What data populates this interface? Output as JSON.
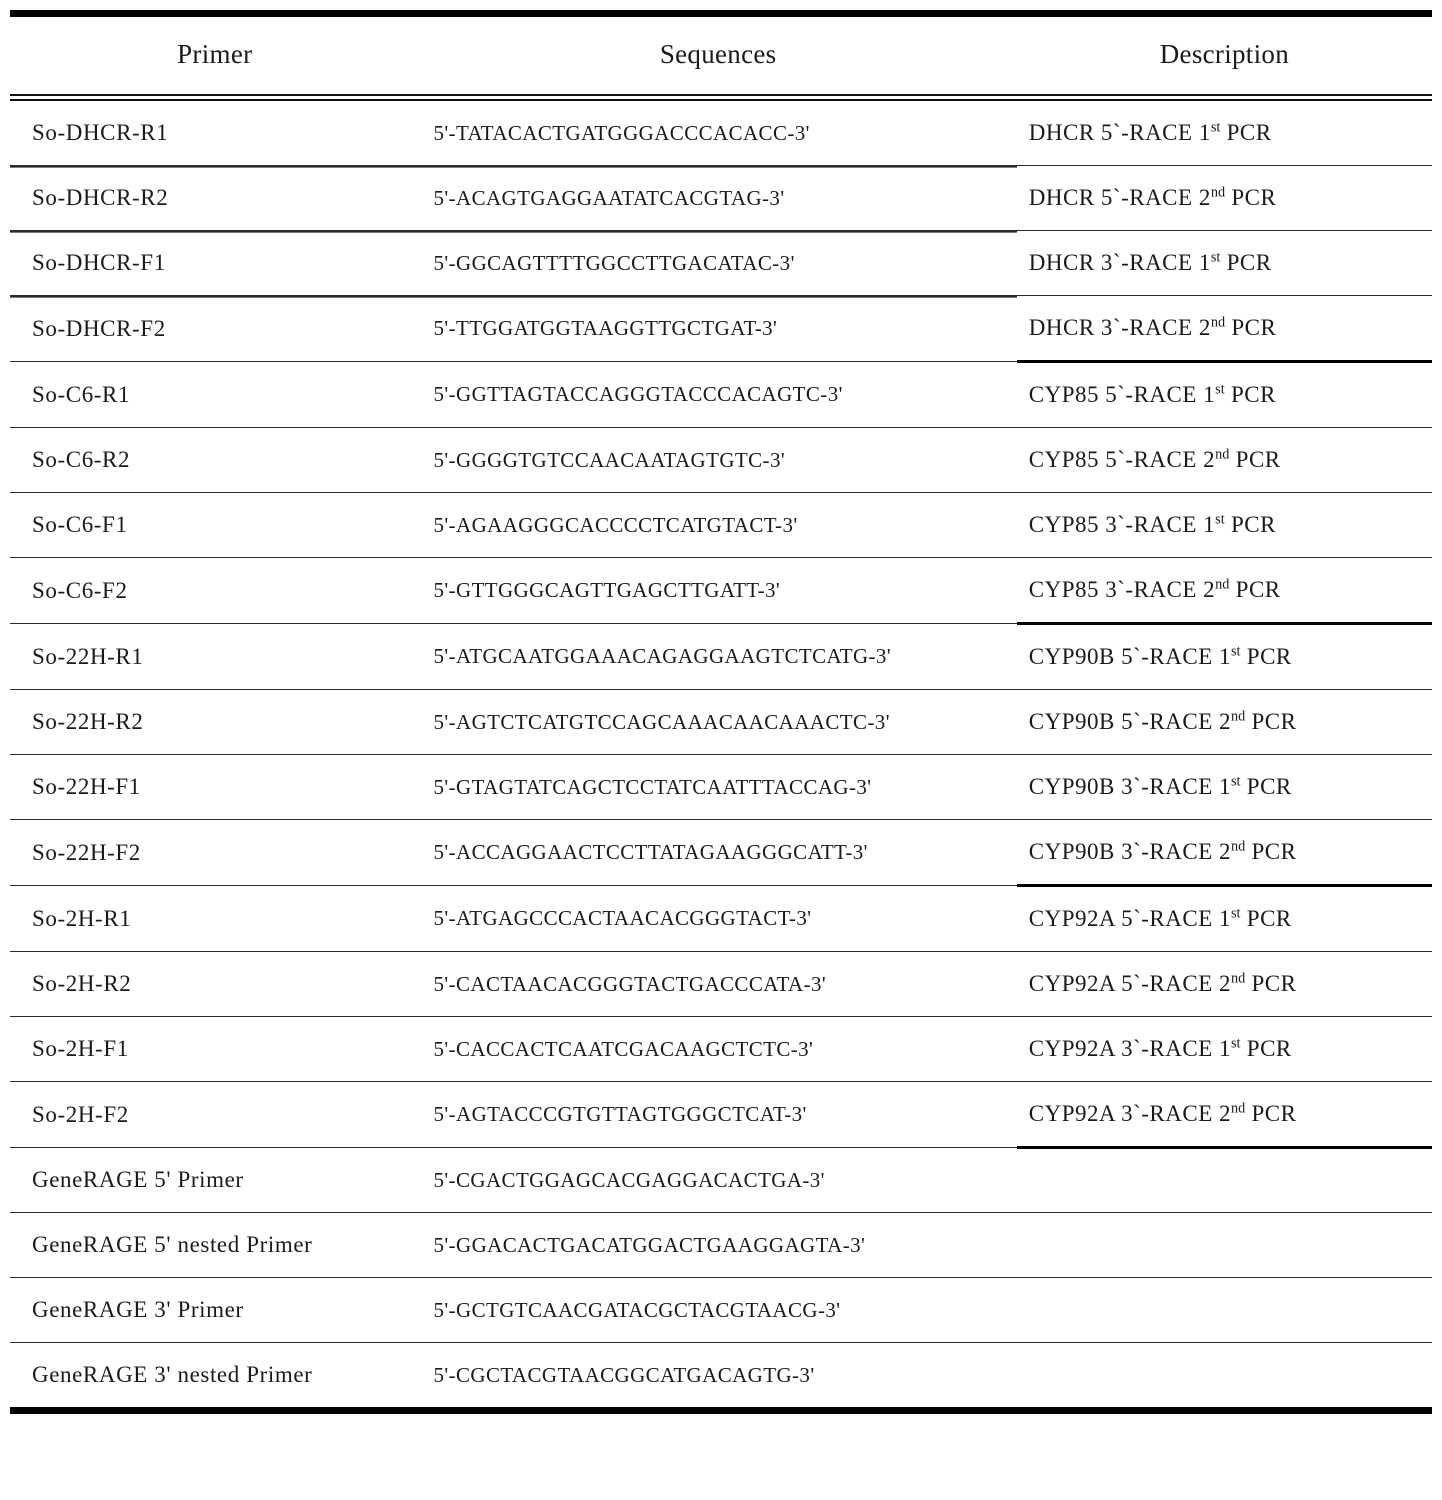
{
  "table": {
    "columns": [
      {
        "key": "primer",
        "label": "Primer"
      },
      {
        "key": "sequence",
        "label": "Sequences"
      },
      {
        "key": "description",
        "label": "Description"
      }
    ],
    "rows": [
      {
        "primer": "So-DHCR-R1",
        "sequence": "5'-TATACACTGATGGGACCCACACC-3'",
        "desc_main": "DHCR 5`-RACE 1",
        "desc_sup": "st",
        "desc_tail": " PCR",
        "description": "DHCR 5`-RACE 1st PCR"
      },
      {
        "primer": "So-DHCR-R2",
        "sequence": "5'-ACAGTGAGGAATATCACGTAG-3'",
        "desc_main": "DHCR 5`-RACE 2",
        "desc_sup": "nd",
        "desc_tail": " PCR",
        "description": "DHCR 5`-RACE 2nd PCR"
      },
      {
        "primer": "So-DHCR-F1",
        "sequence": "5'-GGCAGTTTTGGCCTTGACATAC-3'",
        "desc_main": "DHCR 3`-RACE 1",
        "desc_sup": "st",
        "desc_tail": " PCR",
        "description": "DHCR 3`-RACE 1st PCR"
      },
      {
        "primer": "So-DHCR-F2",
        "sequence": "5'-TTGGATGGTAAGGTTGCTGAT-3'",
        "desc_main": "DHCR 3`-RACE 2",
        "desc_sup": "nd",
        "desc_tail": " PCR",
        "description": "DHCR 3`-RACE 2nd PCR"
      },
      {
        "primer": "So-C6-R1",
        "sequence": "5'-GGTTAGTACCAGGGTACCCACAGTC-3'",
        "desc_main": "CYP85 5`-RACE 1",
        "desc_sup": "st",
        "desc_tail": " PCR",
        "description": "CYP85 5`-RACE 1st PCR"
      },
      {
        "primer": "So-C6-R2",
        "sequence": "5'-GGGGTGTCCAACAATAGTGTC-3'",
        "desc_main": "CYP85 5`-RACE 2",
        "desc_sup": "nd",
        "desc_tail": " PCR",
        "description": "CYP85 5`-RACE 2nd PCR"
      },
      {
        "primer": "So-C6-F1",
        "sequence": "5'-AGAAGGGCACCCCTCATGTACT-3'",
        "desc_main": "CYP85 3`-RACE 1",
        "desc_sup": "st",
        "desc_tail": " PCR",
        "description": "CYP85 3`-RACE 1st PCR"
      },
      {
        "primer": "So-C6-F2",
        "sequence": "5'-GTTGGGCAGTTGAGCTTGATT-3'",
        "desc_main": "CYP85 3`-RACE 2",
        "desc_sup": "nd",
        "desc_tail": " PCR",
        "description": "CYP85 3`-RACE 2nd PCR"
      },
      {
        "primer": "So-22H-R1",
        "sequence": "5'-ATGCAATGGAAACAGAGGAAGTCTCATG-3'",
        "desc_main": "CYP90B 5`-RACE 1",
        "desc_sup": "st",
        "desc_tail": " PCR",
        "description": "CYP90B 5`-RACE 1st PCR"
      },
      {
        "primer": "So-22H-R2",
        "sequence": "5'-AGTCTCATGTCCAGCAAACAACAAACTC-3'",
        "desc_main": "CYP90B 5`-RACE 2",
        "desc_sup": "nd",
        "desc_tail": " PCR",
        "description": "CYP90B 5`-RACE 2nd PCR"
      },
      {
        "primer": "So-22H-F1",
        "sequence": "5'-GTAGTATCAGCTCCTATCAATTTACCAG-3'",
        "desc_main": "CYP90B 3`-RACE 1",
        "desc_sup": "st",
        "desc_tail": " PCR",
        "description": "CYP90B 3`-RACE 1st PCR"
      },
      {
        "primer": "So-22H-F2",
        "sequence": "5'-ACCAGGAACTCCTTATAGAAGGGCATT-3'",
        "desc_main": "CYP90B 3`-RACE 2",
        "desc_sup": "nd",
        "desc_tail": " PCR",
        "description": "CYP90B 3`-RACE 2nd PCR"
      },
      {
        "primer": "So-2H-R1",
        "sequence": "5'-ATGAGCCCACTAACACGGGTACT-3'",
        "desc_main": "CYP92A 5`-RACE 1",
        "desc_sup": "st",
        "desc_tail": " PCR",
        "description": "CYP92A 5`-RACE 1st PCR"
      },
      {
        "primer": "So-2H-R2",
        "sequence": "5'-CACTAACACGGGTACTGACCCATA-3'",
        "desc_main": "CYP92A 5`-RACE 2",
        "desc_sup": "nd",
        "desc_tail": " PCR",
        "description": "CYP92A 5`-RACE 2nd PCR"
      },
      {
        "primer": "So-2H-F1",
        "sequence": "5'-CACCACTCAATCGACAAGCTCTC-3'",
        "desc_main": "CYP92A 3`-RACE 1",
        "desc_sup": "st",
        "desc_tail": " PCR",
        "description": "CYP92A 3`-RACE 1st PCR"
      },
      {
        "primer": "So-2H-F2",
        "sequence": "5'-AGTACCCGTGTTAGTGGGCTCAT-3'",
        "desc_main": "CYP92A 3`-RACE 2",
        "desc_sup": "nd",
        "desc_tail": " PCR",
        "description": "CYP92A 3`-RACE 2nd PCR"
      },
      {
        "primer": "GeneRAGE 5' Primer",
        "sequence": "5'-CGACTGGAGCACGAGGACACTGA-3'",
        "desc_main": "",
        "desc_sup": "",
        "desc_tail": "",
        "description": ""
      },
      {
        "primer": "GeneRAGE 5' nested Primer",
        "sequence": "5'-GGACACTGACATGGACTGAAGGAGTA-3'",
        "desc_main": "",
        "desc_sup": "",
        "desc_tail": "",
        "description": ""
      },
      {
        "primer": "GeneRAGE 3' Primer",
        "sequence": "5'-GCTGTCAACGATACGCTACGTAACG-3'",
        "desc_main": "",
        "desc_sup": "",
        "desc_tail": "",
        "description": ""
      },
      {
        "primer": "GeneRAGE 3' nested Primer",
        "sequence": "5'-CGCTACGTAACGGCATGACAGTG-3'",
        "desc_main": "",
        "desc_sup": "",
        "desc_tail": "",
        "description": ""
      }
    ]
  },
  "style": {
    "rule_color": "#000000",
    "text_color": "#1a1a1a",
    "background": "#ffffff"
  }
}
